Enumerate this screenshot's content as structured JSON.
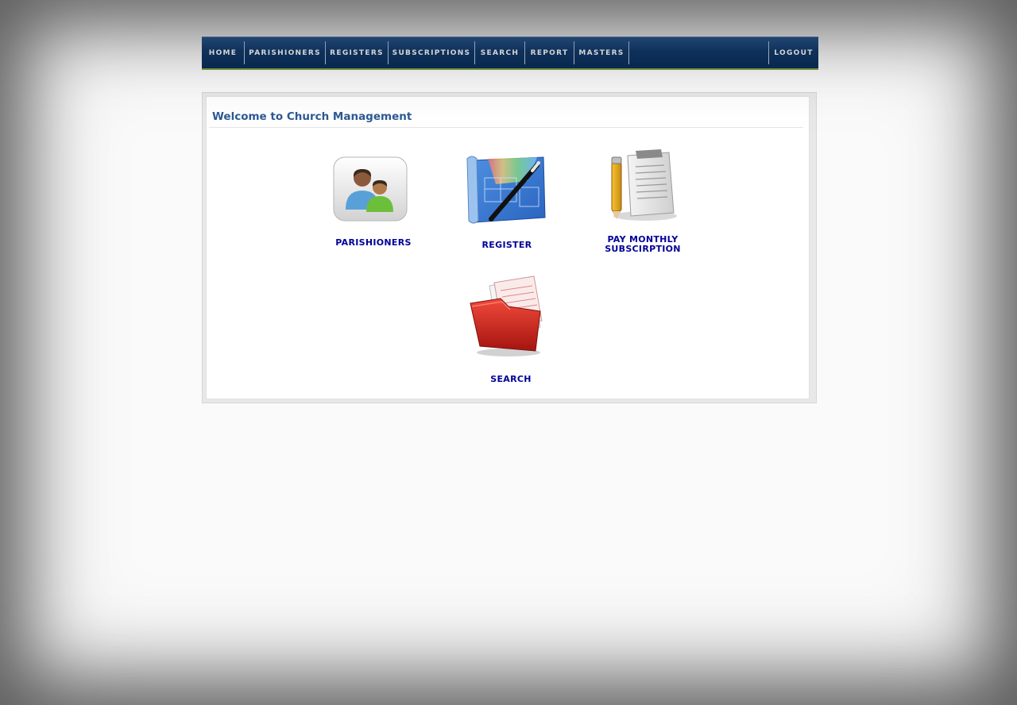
{
  "nav": {
    "items": [
      {
        "label": "HOME"
      },
      {
        "label": "PARISHIONERS"
      },
      {
        "label": "REGISTERS"
      },
      {
        "label": "SUBSCRIPTIONS"
      },
      {
        "label": "SEARCH"
      },
      {
        "label": "REPORT"
      },
      {
        "label": "MASTERS"
      }
    ],
    "logout": "LOGOUT"
  },
  "main": {
    "title": "Welcome to Church Management",
    "tiles": [
      {
        "label": "PARISHIONERS",
        "icon": "parishioners-icon"
      },
      {
        "label": "REGISTER",
        "icon": "register-blueprint-icon"
      },
      {
        "label_line1": "PAY MONTHLY",
        "label_line2": "SUBSCIRPTION",
        "icon": "subscription-notepad-icon"
      },
      {
        "label": "SEARCH",
        "icon": "search-folder-icon"
      }
    ]
  },
  "colors": {
    "nav_top": "#2d5f9a",
    "nav_bottom": "#0a2d57",
    "title": "#2c5a94",
    "link": "#000099"
  }
}
